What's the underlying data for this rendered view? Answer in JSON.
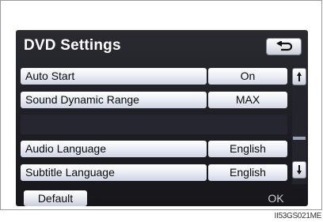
{
  "screen": {
    "title": "DVD Settings",
    "back_icon": "return-arrow-icon",
    "rows": [
      {
        "label": "Auto Start",
        "value": "On"
      },
      {
        "label": "Sound Dynamic Range",
        "value": "MAX"
      },
      {
        "label": "Audio Language",
        "value": "English"
      },
      {
        "label": "Subtitle Language",
        "value": "English"
      }
    ],
    "scroll_up_icon": "scroll-up-arrow-icon",
    "scroll_down_icon": "scroll-down-arrow-icon",
    "default_label": "Default",
    "ok_label": "OK"
  },
  "footer": {
    "code": "II53GS021ME"
  },
  "colors": {
    "screen_bg": "#1c1c22",
    "button_bg": "#e9ecf4",
    "text_dark": "#0b0b0b"
  }
}
